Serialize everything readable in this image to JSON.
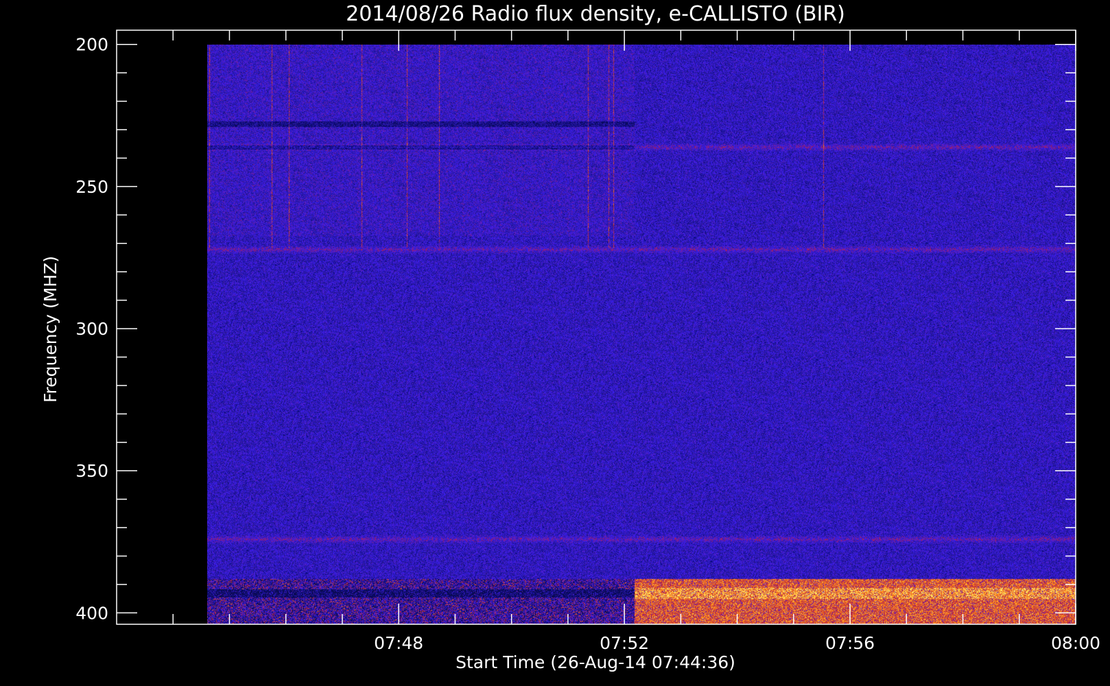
{
  "chart_data": {
    "type": "heatmap",
    "title": "2014/08/26  Radio flux density, e-CALLISTO (BIR)",
    "xlabel": "Start Time (26-Aug-14 07:44:36)",
    "ylabel": "Frequency (MHZ)",
    "x_range": [
      "07:44:36",
      "08:00:00"
    ],
    "xlim_minutes": [
      7.0,
      24.0
    ],
    "x_ticks": [
      {
        "label": "07:48",
        "minute": 12
      },
      {
        "label": "07:52",
        "minute": 16
      },
      {
        "label": "07:56",
        "minute": 20
      },
      {
        "label": "08:00",
        "minute": 24
      }
    ],
    "x_minor_every_minutes": 1,
    "x_time_base": "07:36",
    "ylim": [
      195,
      404
    ],
    "y_ticks": [
      200,
      250,
      300,
      350,
      400
    ],
    "y_minor_every": 10,
    "y_inverted": true,
    "data_extent": {
      "time_start": "07:44:36",
      "time_end": "08:00:00",
      "freq_top": 200,
      "freq_bottom": 404
    },
    "colormap": {
      "low": "#0a0a55",
      "mid": "#2b1ee0",
      "high_red": "#b01818",
      "peak": "#ffd84a"
    },
    "features": [
      {
        "name": "instrument switch",
        "time": "07:52:10"
      },
      {
        "name": "interference band",
        "freq": 236
      },
      {
        "name": "interference band",
        "freq": 272
      },
      {
        "name": "interference band",
        "freq": 374
      },
      {
        "name": "bright emission band",
        "freq_range": [
          388,
          404
        ],
        "time_range": [
          "07:52:00",
          "07:60:00"
        ]
      }
    ]
  }
}
